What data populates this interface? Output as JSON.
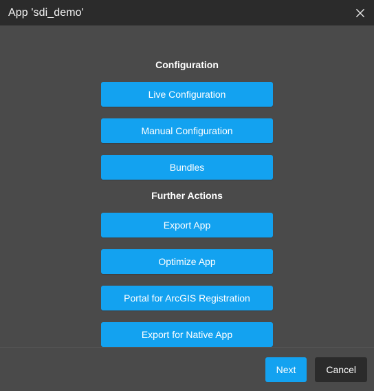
{
  "window": {
    "title": "App 'sdi_demo'",
    "close_icon": "close-icon",
    "titlebar_bg": "#2b2b2b",
    "body_bg": "#4a4a4a",
    "accent": "#13a2f0"
  },
  "sections": [
    {
      "heading": "Configuration",
      "buttons": [
        {
          "label": "Live Configuration"
        },
        {
          "label": "Manual Configuration"
        },
        {
          "label": "Bundles"
        }
      ]
    },
    {
      "heading": "Further Actions",
      "buttons": [
        {
          "label": "Export App"
        },
        {
          "label": "Optimize App"
        },
        {
          "label": "Portal for ArcGIS Registration"
        },
        {
          "label": "Export for Native App"
        }
      ]
    }
  ],
  "footer": {
    "next_label": "Next",
    "cancel_label": "Cancel"
  }
}
